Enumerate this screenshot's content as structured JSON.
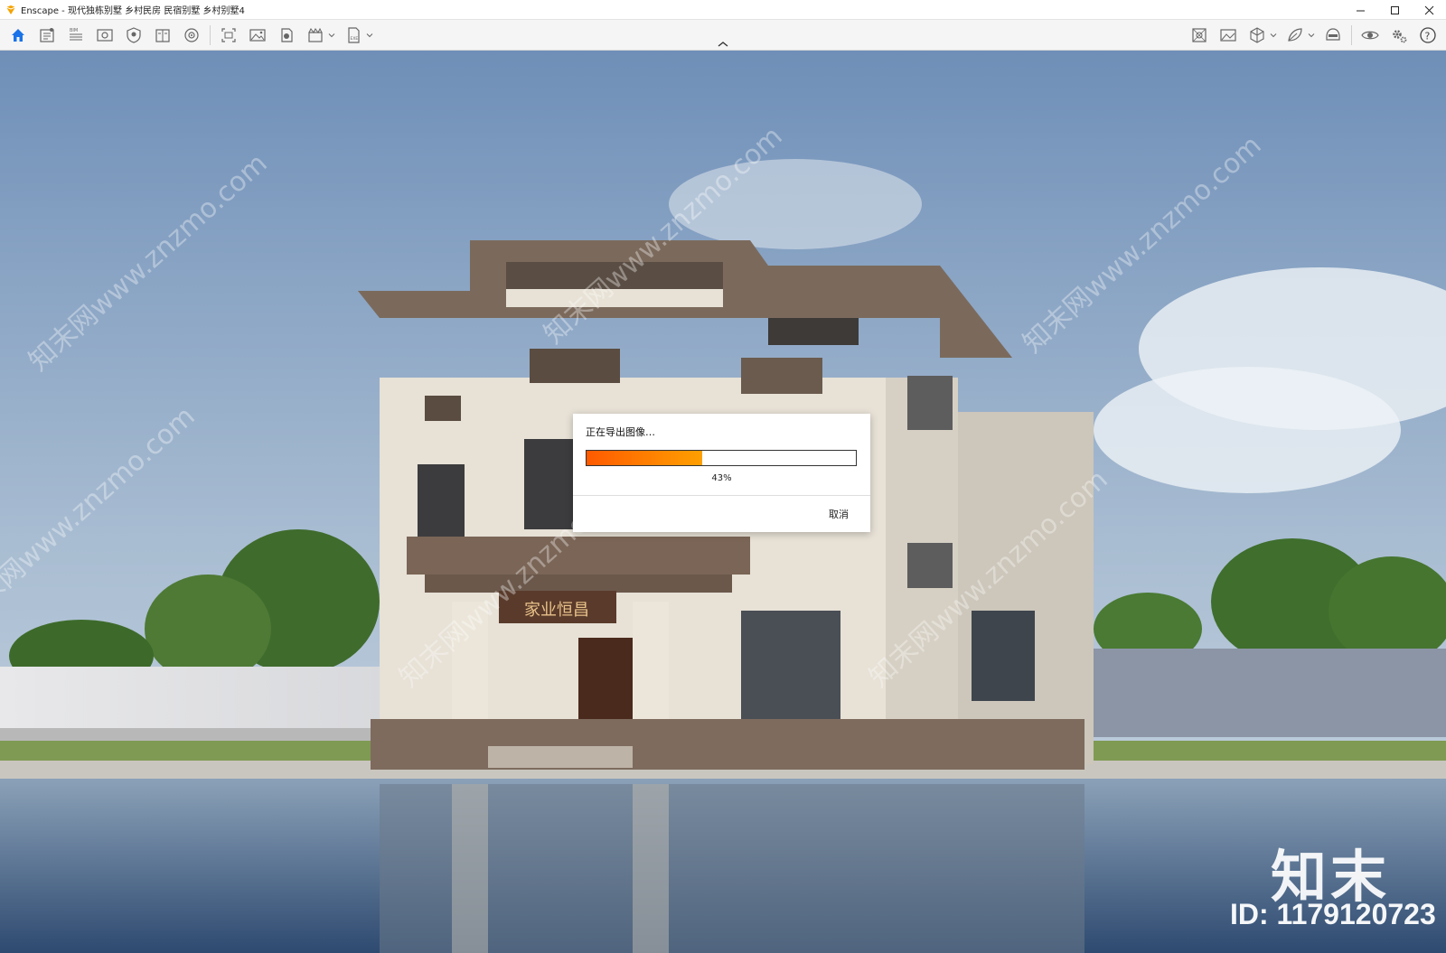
{
  "window": {
    "app_name": "Enscape",
    "title": "Enscape - 现代独栋别墅 乡村民房 民宿别墅 乡村别墅4"
  },
  "toolbar": {
    "left_icons": [
      "home-icon",
      "asset-library-icon",
      "bim-icon",
      "view-icon",
      "safe-frame-icon",
      "compare-icon",
      "vr-icon",
      "screenshot-icon",
      "render-image-icon",
      "batch-render-icon",
      "video-icon",
      "export-exe-icon"
    ],
    "right_icons": [
      "atmosphere-icon",
      "visual-settings-icon",
      "cube-icon",
      "material-icon",
      "helmet-icon",
      "eye-icon",
      "settings-icon",
      "help-icon"
    ]
  },
  "dialog": {
    "title": "正在导出图像…",
    "progress": 0.43,
    "progress_label": "43%",
    "cancel_label": "取消"
  },
  "signboard": "家业恒昌",
  "watermark": {
    "repeated_text": "知末网www.znzmo.com",
    "brand": "知末",
    "id_label": "ID: 1179120723"
  },
  "colors": {
    "progress_start": "#ff5a00",
    "progress_end": "#ffa000",
    "accent_home": "#1a73e8"
  }
}
